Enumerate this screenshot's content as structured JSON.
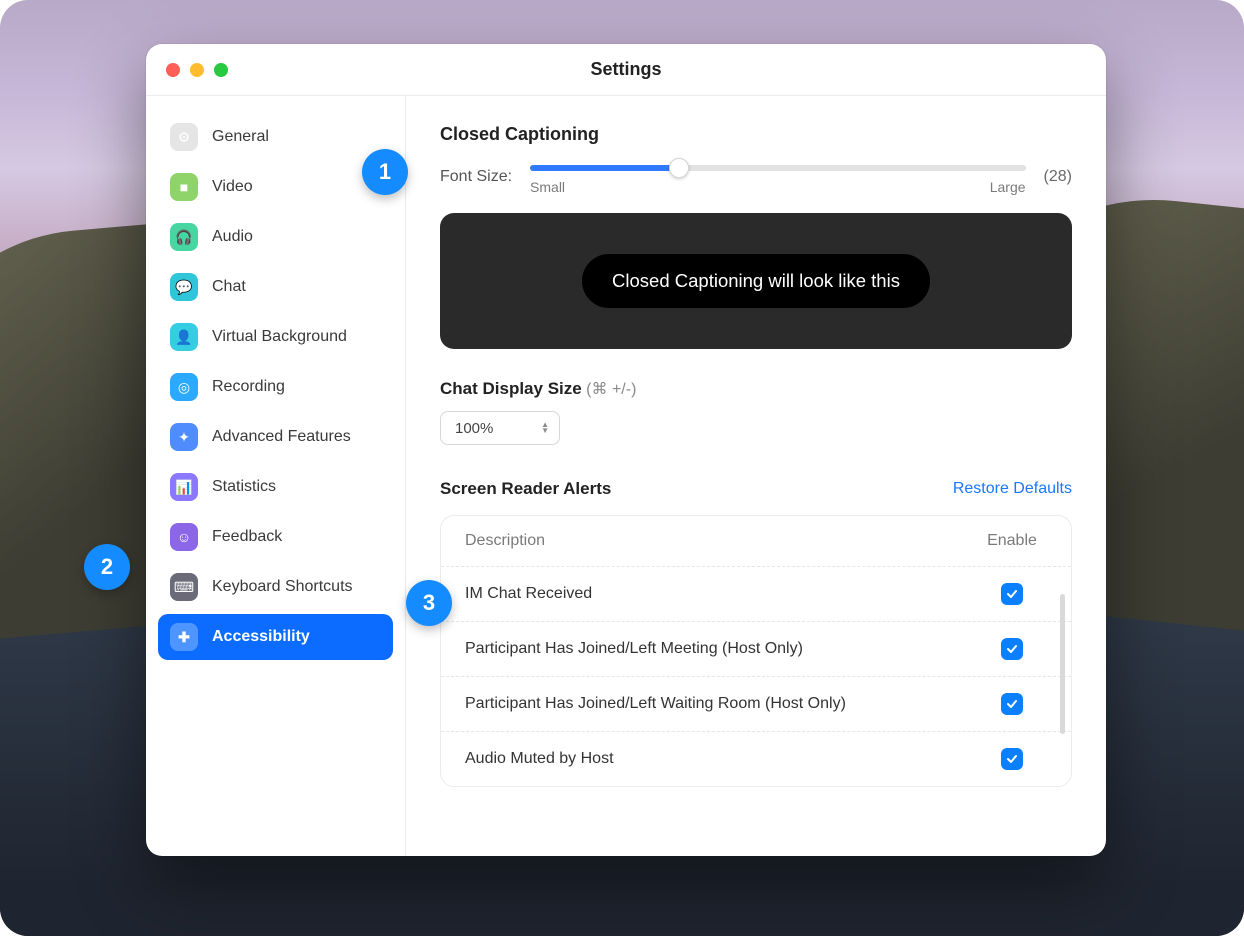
{
  "window": {
    "title": "Settings"
  },
  "sidebar": {
    "items": [
      {
        "id": "general",
        "label": "General",
        "icon": "gear-icon",
        "icon_bg": "#e5e5e5",
        "glyph": "⚙"
      },
      {
        "id": "video",
        "label": "Video",
        "icon": "video-icon",
        "icon_bg": "#8fd36b",
        "glyph": "■"
      },
      {
        "id": "audio",
        "label": "Audio",
        "icon": "audio-icon",
        "icon_bg": "#47d6a2",
        "glyph": "🎧"
      },
      {
        "id": "chat",
        "label": "Chat",
        "icon": "chat-icon",
        "icon_bg": "#2fc6d9",
        "glyph": "💬"
      },
      {
        "id": "virtual-background",
        "label": "Virtual Background",
        "icon": "virtual-bg-icon",
        "icon_bg": "#35cde1",
        "glyph": "👤"
      },
      {
        "id": "recording",
        "label": "Recording",
        "icon": "recording-icon",
        "icon_bg": "#2aa9ff",
        "glyph": "◎"
      },
      {
        "id": "advanced",
        "label": "Advanced Features",
        "icon": "advanced-icon",
        "icon_bg": "#4f8dff",
        "glyph": "✦"
      },
      {
        "id": "statistics",
        "label": "Statistics",
        "icon": "statistics-icon",
        "icon_bg": "#8a78ff",
        "glyph": "📊"
      },
      {
        "id": "feedback",
        "label": "Feedback",
        "icon": "feedback-icon",
        "icon_bg": "#8b66e6",
        "glyph": "☺"
      },
      {
        "id": "keyboard-shortcuts",
        "label": "Keyboard Shortcuts",
        "icon": "keyboard-icon",
        "icon_bg": "#6a6a78",
        "glyph": "⌨"
      },
      {
        "id": "accessibility",
        "label": "Accessibility",
        "icon": "accessibility-icon",
        "icon_bg": "#0b6cff",
        "glyph": "✚",
        "active": true
      }
    ]
  },
  "closed_captioning": {
    "heading": "Closed Captioning",
    "label": "Font Size:",
    "value_display": "(28)",
    "min_label": "Small",
    "max_label": "Large",
    "slider_percent": 30,
    "preview_text": "Closed Captioning will look like this"
  },
  "chat_display": {
    "heading": "Chat Display Size",
    "hint": "(⌘ +/-)",
    "value": "100%"
  },
  "screen_reader": {
    "heading": "Screen Reader Alerts",
    "restore_label": "Restore Defaults",
    "col_description": "Description",
    "col_enable": "Enable",
    "rows": [
      {
        "desc": "IM Chat Received",
        "enabled": true
      },
      {
        "desc": "Participant Has Joined/Left Meeting (Host Only)",
        "enabled": true
      },
      {
        "desc": "Participant Has Joined/Left Waiting Room (Host Only)",
        "enabled": true
      },
      {
        "desc": "Audio Muted by Host",
        "enabled": true
      }
    ]
  },
  "annotations": {
    "b1": "1",
    "b2": "2",
    "b3": "3"
  }
}
